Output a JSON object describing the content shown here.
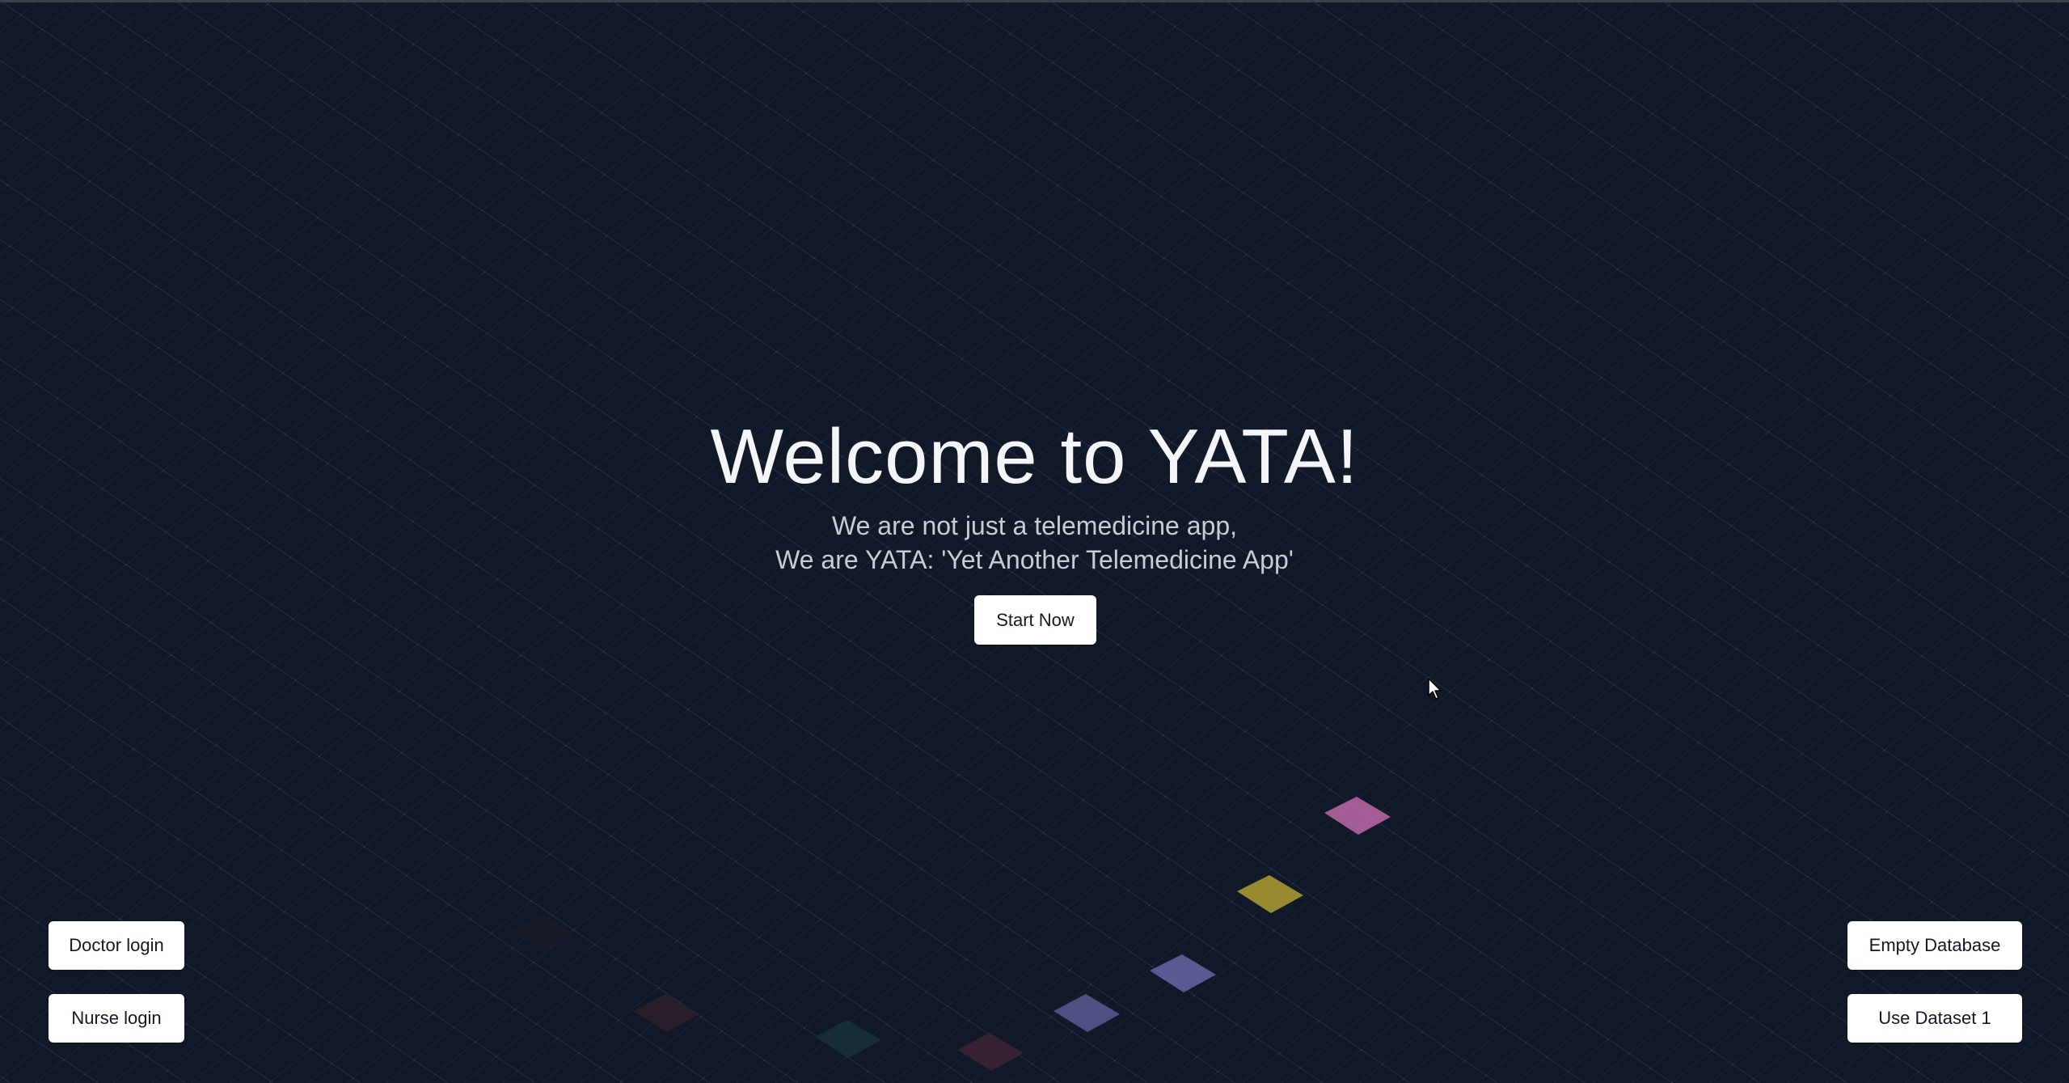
{
  "hero": {
    "title": "Welcome to YATA!",
    "subtitle_line1": "We are not just a telemedicine app,",
    "subtitle_line2": "We are YATA: 'Yet Another Telemedicine App'",
    "start_label": "Start Now"
  },
  "login": {
    "doctor_label": "Doctor login",
    "nurse_label": "Nurse login"
  },
  "database": {
    "empty_label": "Empty Database",
    "dataset_label": "Use Dataset 1"
  },
  "colors": {
    "background": "#111827",
    "tile_pink": "#c86fb0",
    "tile_yellow": "#b9a832",
    "tile_indigo": "#7370b8",
    "tile_dim_maroon": "#3a2233",
    "tile_dim_teal": "#16303a"
  },
  "icons": {
    "cursor": "mouse-pointer-icon"
  }
}
